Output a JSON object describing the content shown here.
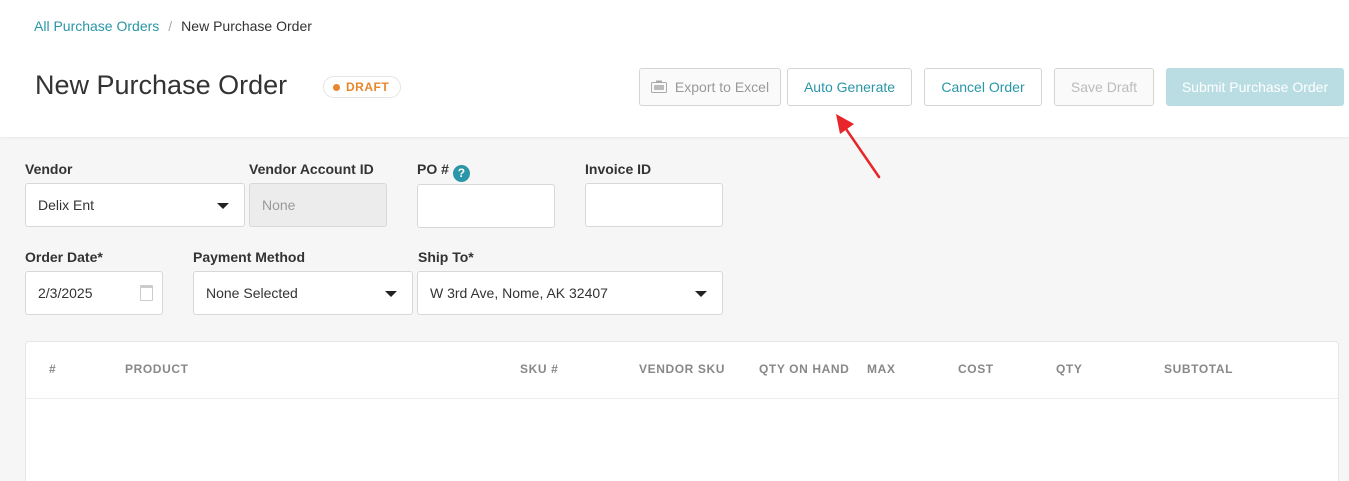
{
  "breadcrumb": {
    "parent": "All Purchase Orders",
    "separator": "/",
    "current": "New Purchase Order"
  },
  "header": {
    "title": "New Purchase Order",
    "status": "DRAFT",
    "status_color": "#e8862e"
  },
  "toolbar": {
    "export_label": "Export to Excel",
    "auto_generate_label": "Auto Generate",
    "cancel_label": "Cancel Order",
    "save_label": "Save Draft",
    "submit_label": "Submit Purchase Order"
  },
  "form": {
    "vendor": {
      "label": "Vendor",
      "value": "Delix Ent"
    },
    "vendor_account_id": {
      "label": "Vendor Account ID",
      "value": "None"
    },
    "po_number": {
      "label": "PO #",
      "value": "",
      "help": "?"
    },
    "invoice_id": {
      "label": "Invoice ID",
      "value": ""
    },
    "order_date": {
      "label": "Order Date*",
      "value": "2/3/2025"
    },
    "payment_method": {
      "label": "Payment Method",
      "value": "None Selected"
    },
    "ship_to": {
      "label": "Ship To*",
      "value": "W 3rd Ave, Nome, AK 32407"
    }
  },
  "table": {
    "columns": [
      "#",
      "PRODUCT",
      "SKU #",
      "VENDOR SKU",
      "QTY ON HAND",
      "MAX",
      "COST",
      "QTY",
      "SUBTOTAL"
    ]
  },
  "colors": {
    "accent": "#2a96a8",
    "annotation_arrow": "#e8252a"
  }
}
